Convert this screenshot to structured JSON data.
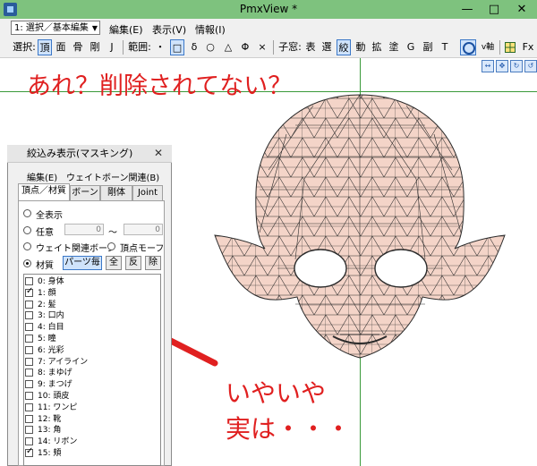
{
  "window": {
    "title": "PmxView *",
    "minimize": "—",
    "maximize": "□",
    "close": "✕"
  },
  "menubar": {
    "mode_select": "1: 選択／基本編集",
    "items": [
      "編集(E)",
      "表示(V)",
      "情報(I)"
    ]
  },
  "toolbar": {
    "select_label": "選択:",
    "select_items": [
      "頂",
      "面",
      "骨",
      "剛",
      "J"
    ],
    "range_label": "範囲:",
    "range_items": [
      "・",
      "□",
      "δ",
      "○",
      "△",
      "Φ",
      "×"
    ],
    "window_label": "子窓:",
    "window_items": [
      "表",
      "選",
      "絞",
      "動",
      "拡",
      "塗",
      "G",
      "副",
      "T"
    ],
    "v_label": "v軸",
    "fx_label": "Fx"
  },
  "viewport": {
    "nav_icons": [
      "↔",
      "✥",
      "↻",
      "↺"
    ]
  },
  "annotations": {
    "top": "あれ？削除されてない？",
    "bottom_line1": "いやいや",
    "bottom_line2": "実は・・・"
  },
  "panel": {
    "title": "絞込み表示(マスキング)",
    "menu": [
      "編集(E)",
      "ウェイトボーン関連(B)"
    ],
    "tabs": [
      "頂点／材質",
      "ボーン",
      "剛体",
      "Joint"
    ],
    "options": {
      "all": "全表示",
      "any": "任意",
      "any_from": "0",
      "any_tilde": "〜",
      "any_to": "0",
      "weight_bone": "ウェイト関連ボーン",
      "vertex_morph": "頂点モーフ",
      "material": "材質",
      "per_parts": "パーツ毎",
      "all_btn": "全",
      "invert_btn": "反",
      "remove_btn": "除"
    },
    "materials": [
      {
        "label": "0: 身体",
        "checked": false
      },
      {
        "label": "1: 顔",
        "checked": true
      },
      {
        "label": "2: 髪",
        "checked": false
      },
      {
        "label": "3: 口内",
        "checked": false
      },
      {
        "label": "4: 白目",
        "checked": false
      },
      {
        "label": "5: 瞳",
        "checked": false
      },
      {
        "label": "6: 光彩",
        "checked": false
      },
      {
        "label": "7: アイライン",
        "checked": false
      },
      {
        "label": "8: まゆげ",
        "checked": false
      },
      {
        "label": "9: まつげ",
        "checked": false
      },
      {
        "label": "10: 頭皮",
        "checked": false
      },
      {
        "label": "11: ワンピ",
        "checked": false
      },
      {
        "label": "12: 靴",
        "checked": false
      },
      {
        "label": "13: 角",
        "checked": false
      },
      {
        "label": "14: リボン",
        "checked": false
      },
      {
        "label": "15: 頬",
        "checked": true
      }
    ]
  },
  "colors": {
    "titlebar": "#7ec27e",
    "annotation": "#e02020",
    "mesh_fill": "#f4d4c8",
    "mesh_line": "#2a2a2a",
    "axis": "#3a9a3a"
  }
}
